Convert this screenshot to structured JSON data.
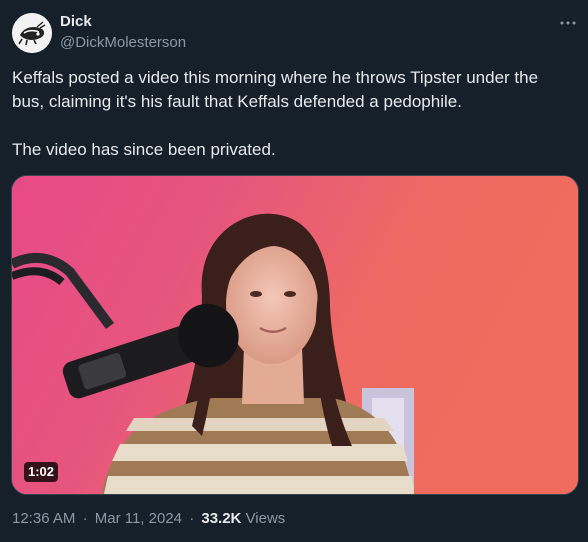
{
  "author": {
    "display_name": "Dick",
    "handle": "@DickMolesterson",
    "avatar_icon": "avatar-sketch-icon"
  },
  "more_icon": "more-options-icon",
  "tweet": {
    "paragraph1": "Keffals posted a video this morning where he throws Tipster under the bus, claiming it's his fault that Keffals defended a pedophile.",
    "paragraph2": "The video has since been privated."
  },
  "video": {
    "duration": "1:02"
  },
  "meta": {
    "time": "12:36 AM",
    "date": "Mar 11, 2024",
    "views_count": "33.2K",
    "views_label": "Views",
    "separator": "·"
  },
  "colors": {
    "background": "#15202b",
    "text_primary": "#e7e9ea",
    "text_secondary": "#8b98a5"
  }
}
